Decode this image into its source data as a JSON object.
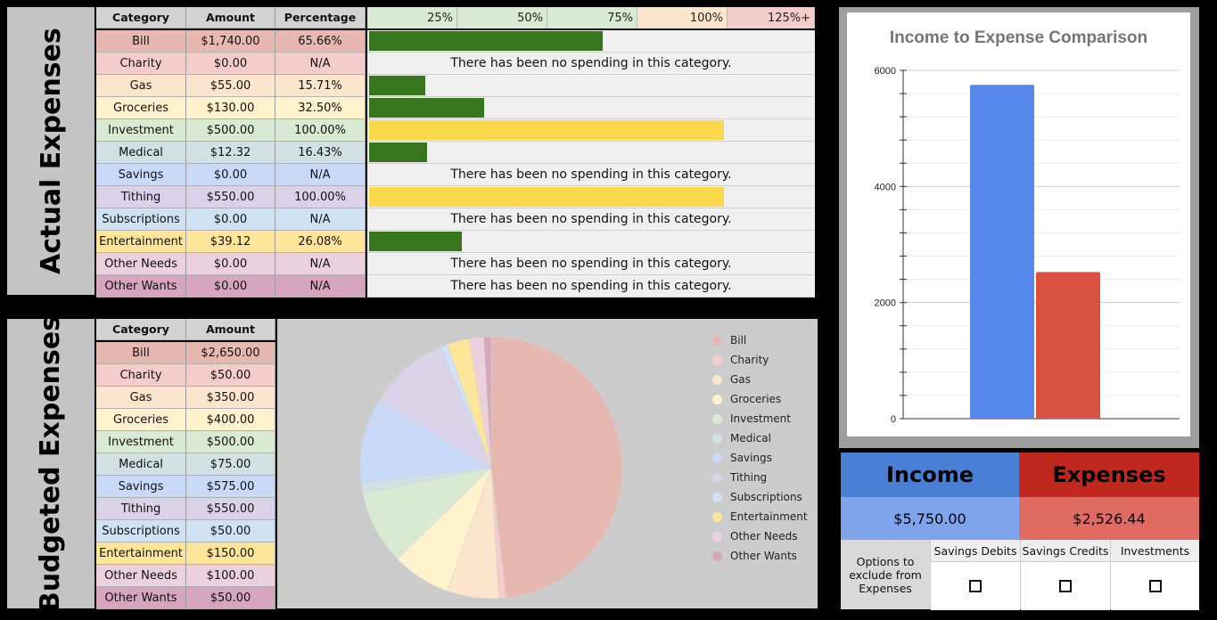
{
  "actual": {
    "title": "Actual Expenses",
    "headers": {
      "category": "Category",
      "amount": "Amount",
      "percentage": "Percentage"
    },
    "scale": [
      "25%",
      "50%",
      "75%",
      "100%",
      "125%+"
    ],
    "scale_colors": [
      "#d9ead3",
      "#d9ead3",
      "#d9ead3",
      "#fce5cd",
      "#f4cccc"
    ],
    "no_spending_text": "There has been no spending in this category.",
    "rows": [
      {
        "category": "Bill",
        "amount": "$1,740.00",
        "percentage": "65.66%",
        "fraction": 0.6566,
        "color": "#e6b8af",
        "bar_color": "#38761d"
      },
      {
        "category": "Charity",
        "amount": "$0.00",
        "percentage": "N/A",
        "fraction": 0,
        "color": "#f4cccc",
        "bar_color": ""
      },
      {
        "category": "Gas",
        "amount": "$55.00",
        "percentage": "15.71%",
        "fraction": 0.1571,
        "color": "#fce5cd",
        "bar_color": "#38761d"
      },
      {
        "category": "Groceries",
        "amount": "$130.00",
        "percentage": "32.50%",
        "fraction": 0.325,
        "color": "#fff2cc",
        "bar_color": "#38761d"
      },
      {
        "category": "Investment",
        "amount": "$500.00",
        "percentage": "100.00%",
        "fraction": 1.0,
        "color": "#d9ead3",
        "bar_color": "#f9d84a"
      },
      {
        "category": "Medical",
        "amount": "$12.32",
        "percentage": "16.43%",
        "fraction": 0.1643,
        "color": "#d0e0e3",
        "bar_color": "#38761d"
      },
      {
        "category": "Savings",
        "amount": "$0.00",
        "percentage": "N/A",
        "fraction": 0,
        "color": "#c9daf8",
        "bar_color": ""
      },
      {
        "category": "Tithing",
        "amount": "$550.00",
        "percentage": "100.00%",
        "fraction": 1.0,
        "color": "#d9d2e9",
        "bar_color": "#f9d84a"
      },
      {
        "category": "Subscriptions",
        "amount": "$0.00",
        "percentage": "N/A",
        "fraction": 0,
        "color": "#cfe2f3",
        "bar_color": ""
      },
      {
        "category": "Entertainment",
        "amount": "$39.12",
        "percentage": "26.08%",
        "fraction": 0.2608,
        "color": "#ffe599",
        "bar_color": "#38761d"
      },
      {
        "category": "Other Needs",
        "amount": "$0.00",
        "percentage": "N/A",
        "fraction": 0,
        "color": "#ead1dc",
        "bar_color": ""
      },
      {
        "category": "Other Wants",
        "amount": "$0.00",
        "percentage": "N/A",
        "fraction": 0,
        "color": "#d5a6bd",
        "bar_color": ""
      }
    ]
  },
  "budgeted": {
    "title": "Budgeted Expenses",
    "headers": {
      "category": "Category",
      "amount": "Amount"
    },
    "rows": [
      {
        "category": "Bill",
        "amount": "$2,650.00",
        "color": "#e6b8af"
      },
      {
        "category": "Charity",
        "amount": "$50.00",
        "color": "#f4cccc"
      },
      {
        "category": "Gas",
        "amount": "$350.00",
        "color": "#fce5cd"
      },
      {
        "category": "Groceries",
        "amount": "$400.00",
        "color": "#fff2cc"
      },
      {
        "category": "Investment",
        "amount": "$500.00",
        "color": "#d9ead3"
      },
      {
        "category": "Medical",
        "amount": "$75.00",
        "color": "#d0e0e3"
      },
      {
        "category": "Savings",
        "amount": "$575.00",
        "color": "#c9daf8"
      },
      {
        "category": "Tithing",
        "amount": "$550.00",
        "color": "#d9d2e9"
      },
      {
        "category": "Subscriptions",
        "amount": "$50.00",
        "color": "#cfe2f3"
      },
      {
        "category": "Entertainment",
        "amount": "$150.00",
        "color": "#ffe599"
      },
      {
        "category": "Other Needs",
        "amount": "$100.00",
        "color": "#ead1dc"
      },
      {
        "category": "Other Wants",
        "amount": "$50.00",
        "color": "#d5a6bd"
      }
    ]
  },
  "chart_data": [
    {
      "type": "pie",
      "title": "",
      "categories": [
        "Bill",
        "Charity",
        "Gas",
        "Groceries",
        "Investment",
        "Medical",
        "Savings",
        "Tithing",
        "Subscriptions",
        "Entertainment",
        "Other Needs",
        "Other Wants"
      ],
      "values": [
        2650,
        50,
        350,
        400,
        500,
        75,
        575,
        550,
        50,
        150,
        100,
        50
      ],
      "colors": [
        "#e6b8af",
        "#f4cccc",
        "#fce5cd",
        "#fff2cc",
        "#d9ead3",
        "#d0e0e3",
        "#c9daf8",
        "#d9d2e9",
        "#cfe2f3",
        "#ffe599",
        "#ead1dc",
        "#d5a6bd"
      ],
      "legend": "right"
    },
    {
      "type": "bar",
      "title": "Income to Expense Comparison",
      "categories": [
        "Income",
        "Expenses"
      ],
      "values": [
        5750,
        2526.44
      ],
      "colors": [
        "#5586ec",
        "#db5142"
      ],
      "ylim": [
        0,
        6000
      ],
      "yticks": [
        "0",
        "2000",
        "4000",
        "6000"
      ],
      "grid": true
    }
  ],
  "summary": {
    "income_label": "Income",
    "expenses_label": "Expenses",
    "income_value": "$5,750.00",
    "expenses_value": "$2,526.44",
    "options_label": "Options to exclude from Expenses",
    "options": [
      "Savings Debits",
      "Savings Credits",
      "Investments"
    ]
  }
}
